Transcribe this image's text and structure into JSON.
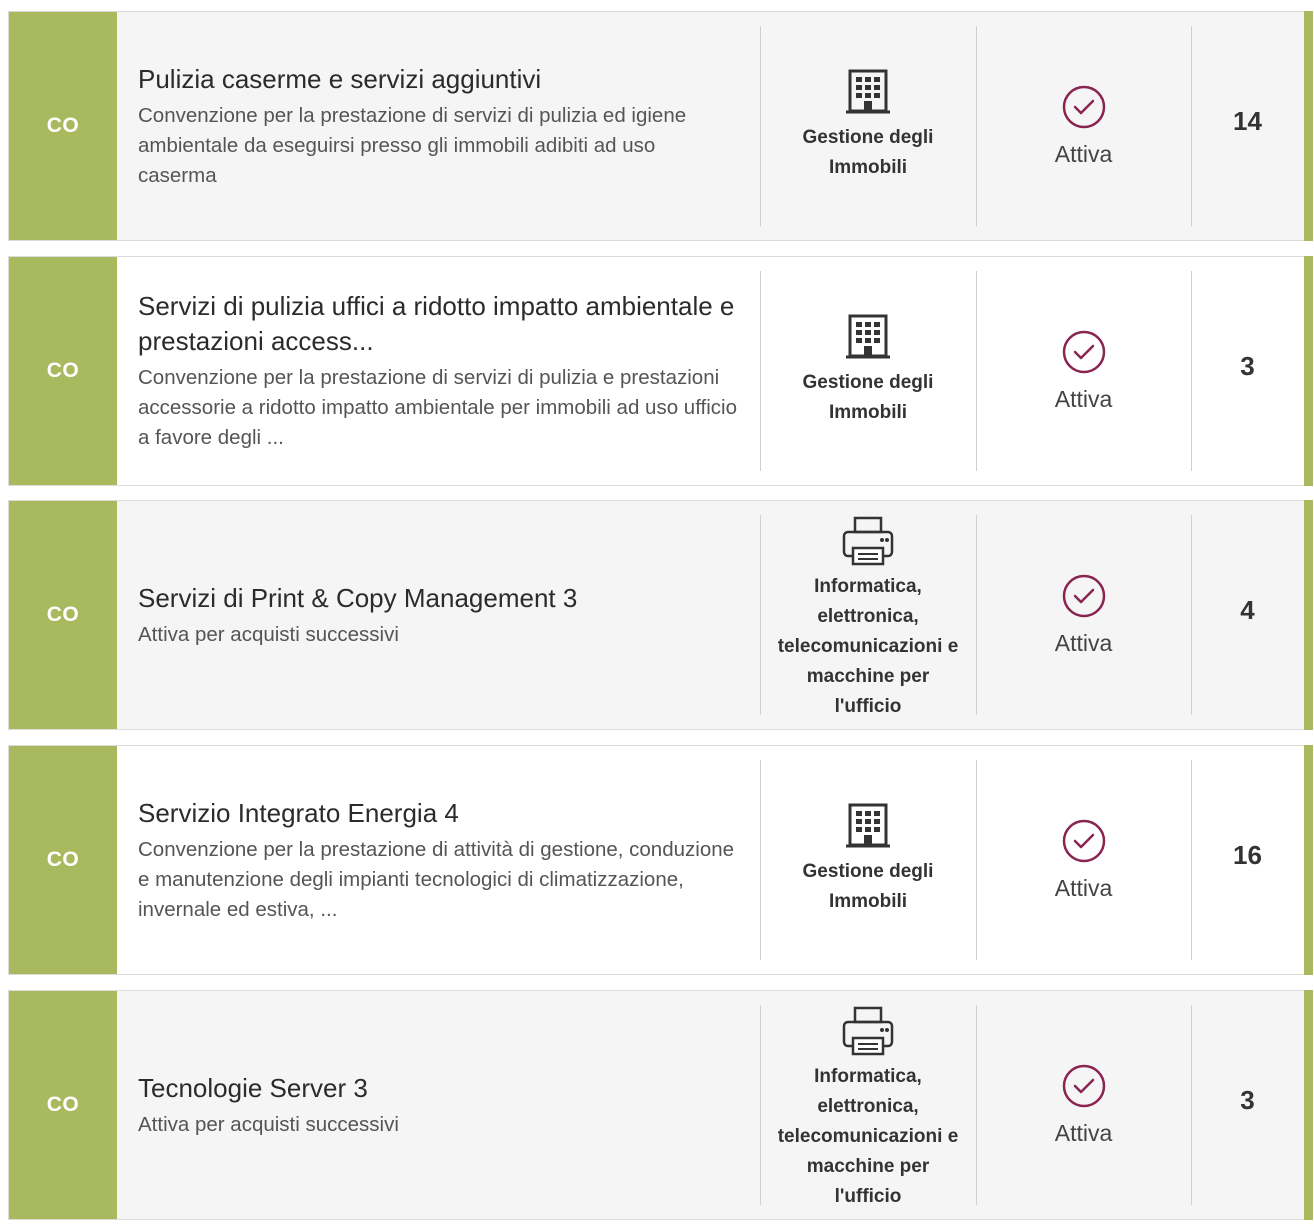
{
  "theme": {
    "accent": "#a9ba5e",
    "status_color": "#8a2451"
  },
  "items": [
    {
      "badge": "CO",
      "title": "Pulizia caserme e servizi aggiuntivi",
      "description": "Convenzione per la prestazione di servizi di pulizia ed igiene ambientale da eseguirsi presso gli immobili adibiti ad uso caserma",
      "category": "Gestione degli Immobili",
      "category_icon": "building-icon",
      "status": "Attiva",
      "status_icon": "check-circle-icon",
      "count": "14"
    },
    {
      "badge": "CO",
      "title": "Servizi di pulizia uffici a ridotto impatto ambientale e prestazioni access...",
      "description": "Convenzione per la prestazione di servizi di pulizia e prestazioni accessorie a ridotto impatto ambientale per immobili ad uso ufficio a favore degli ...",
      "category": "Gestione degli Immobili",
      "category_icon": "building-icon",
      "status": "Attiva",
      "status_icon": "check-circle-icon",
      "count": "3"
    },
    {
      "badge": "CO",
      "title": "Servizi di Print & Copy Management 3",
      "description": "Attiva per acquisti successivi",
      "category": "Informatica, elettronica, telecomunicazioni e macchine per l'ufficio",
      "category_icon": "printer-icon",
      "status": "Attiva",
      "status_icon": "check-circle-icon",
      "count": "4"
    },
    {
      "badge": "CO",
      "title": "Servizio Integrato Energia 4",
      "description": "Convenzione per la prestazione di attività di gestione, conduzione e manutenzione degli impianti tecnologici di climatizzazione, invernale ed estiva, ...",
      "category": "Gestione degli Immobili",
      "category_icon": "building-icon",
      "status": "Attiva",
      "status_icon": "check-circle-icon",
      "count": "16"
    },
    {
      "badge": "CO",
      "title": "Tecnologie Server 3",
      "description": "Attiva per acquisti successivi",
      "category": "Informatica, elettronica, telecomunicazioni e macchine per l'ufficio",
      "category_icon": "printer-icon",
      "status": "Attiva",
      "status_icon": "check-circle-icon",
      "count": "3"
    }
  ]
}
